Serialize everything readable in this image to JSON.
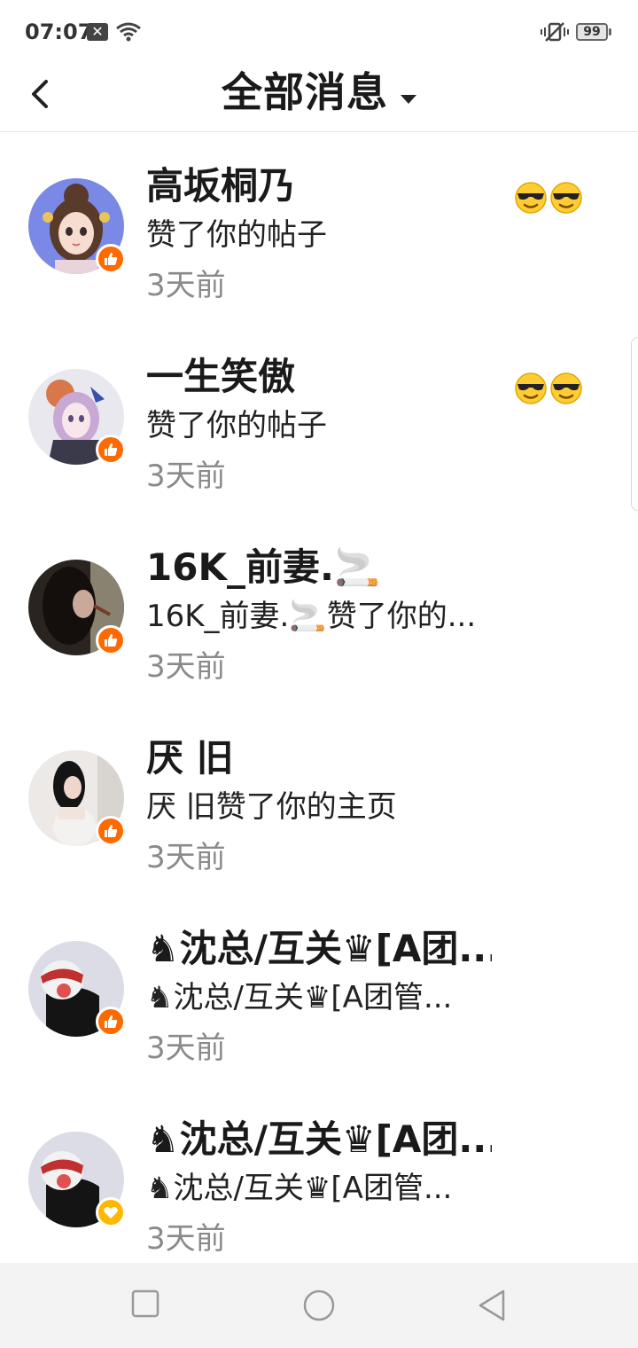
{
  "status": {
    "time": "07:07",
    "battery": "99"
  },
  "header": {
    "title": "全部消息"
  },
  "messages": [
    {
      "name": "高坂桐乃",
      "action": "赞了你的帖子",
      "time": "3天前",
      "badge": "like",
      "emoji_count": 2,
      "avatar": "anime-girl-blue"
    },
    {
      "name": "一生笑傲",
      "action": "赞了你的帖子",
      "time": "3天前",
      "badge": "like",
      "emoji_count": 2,
      "avatar": "anime-girl-purple"
    },
    {
      "name": "16K_前妻.🚬",
      "action": "16K_前妻.🚬赞了你的...",
      "time": "3天前",
      "badge": "like",
      "emoji_count": 0,
      "avatar": "dark-portrait"
    },
    {
      "name": "厌 旧",
      "action": "厌 旧赞了你的主页",
      "time": "3天前",
      "badge": "like",
      "emoji_count": 0,
      "avatar": "girl-photo"
    },
    {
      "name": "♞沈总/互关♛[A团...",
      "action": "♞沈总/互关♛[A团管...",
      "time": "3天前",
      "badge": "like",
      "emoji_count": 0,
      "avatar": "masked-figure"
    },
    {
      "name": "♞沈总/互关♛[A团...",
      "action": "♞沈总/互关♛[A团管...",
      "time": "3天前",
      "badge": "heart",
      "emoji_count": 0,
      "avatar": "masked-figure"
    }
  ],
  "icons": {
    "like_badge": "thumbs-up-icon",
    "heart_badge": "heart-icon",
    "emoji": "cool-face-emoji"
  },
  "colors": {
    "like": "#ff6a00",
    "heart": "#ffb800",
    "time_text": "#8a8a8a"
  }
}
